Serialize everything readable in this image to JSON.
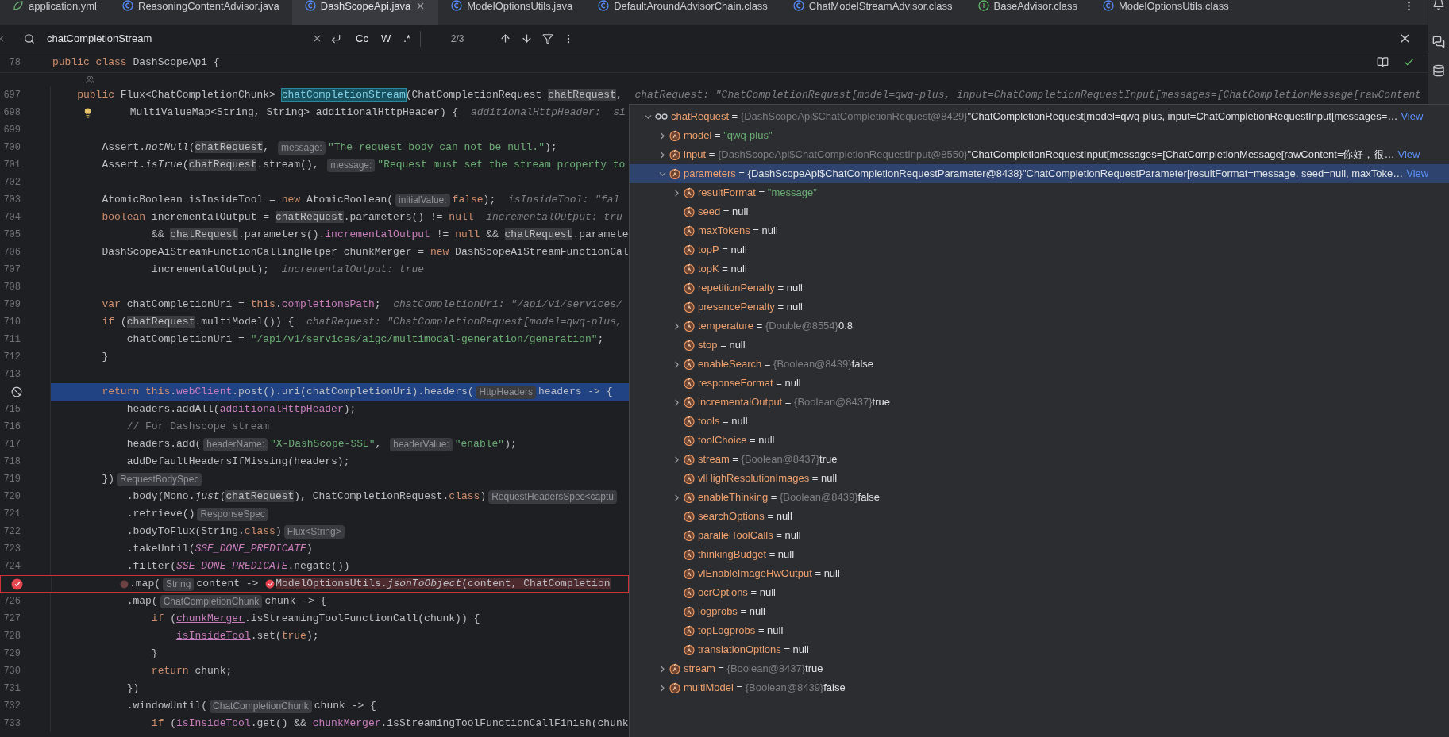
{
  "tabs": [
    {
      "label": "application.yml",
      "kind": "yaml",
      "selected": false
    },
    {
      "label": "ReasoningContentAdvisor.java",
      "kind": "class",
      "selected": false
    },
    {
      "label": "DashScopeApi.java",
      "kind": "class",
      "selected": true
    },
    {
      "label": "ModelOptionsUtils.java",
      "kind": "class",
      "selected": false
    },
    {
      "label": "DefaultAroundAdvisorChain.class",
      "kind": "class",
      "selected": false
    },
    {
      "label": "ChatModelStreamAdvisor.class",
      "kind": "class",
      "selected": false
    },
    {
      "label": "BaseAdvisor.class",
      "kind": "interface",
      "selected": false
    },
    {
      "label": "ModelOptionsUtils.class",
      "kind": "class",
      "selected": false
    }
  ],
  "search": {
    "value": "chatCompletionStream",
    "options": [
      "Cc",
      "W",
      ".*"
    ],
    "counter": "2/3"
  },
  "editor": {
    "sticky_line": {
      "number": "78",
      "tokens": [
        {
          "kind": "kw",
          "text": "public class "
        },
        {
          "kind": "p",
          "text": "DashScopeApi {"
        }
      ]
    },
    "first_line": {
      "number": "697",
      "tokens": [
        {
          "kind": "kw",
          "text": "    public "
        },
        {
          "kind": "p",
          "text": "Flux<ChatCompletionChunk> "
        },
        {
          "kind": "m",
          "text": "chatCompletionStream"
        },
        {
          "kind": "p",
          "text": "(ChatCompletionRequest "
        },
        {
          "kind": "v",
          "text": "chatRequest"
        },
        {
          "kind": "p",
          "text": ",  "
        },
        {
          "kind": "d",
          "text": "chatRequest: \"ChatCompletionRequest[model=qwq-plus, input=ChatCompletionRequestInput[messages=[ChatCompletionMessage[rawContent"
        }
      ]
    },
    "lines": [
      {
        "number": "698",
        "current": false,
        "breakpoint": false,
        "tokens": [
          {
            "kind": "bulb"
          },
          {
            "kind": "p",
            "text": "      MultiValueMap<String, String> additionalHttpHeader) {  "
          },
          {
            "kind": "d",
            "text": "additionalHttpHeader:  si"
          }
        ]
      },
      {
        "number": "699",
        "current": false,
        "breakpoint": false
      },
      {
        "number": "700",
        "current": false,
        "breakpoint": false,
        "tokens": [
          {
            "kind": "p",
            "text": "        Assert."
          },
          {
            "kind": "i",
            "text": "notNull"
          },
          {
            "kind": "p",
            "text": "("
          },
          {
            "kind": "v",
            "text": "chatRequest"
          },
          {
            "kind": "p",
            "text": ", "
          },
          {
            "kind": "h",
            "text": "message:"
          },
          {
            "kind": "s",
            "text": "\"The request body can not be null.\""
          },
          {
            "kind": "p",
            "text": ");"
          }
        ]
      },
      {
        "number": "701",
        "current": false,
        "breakpoint": false,
        "tokens": [
          {
            "kind": "p",
            "text": "        Assert."
          },
          {
            "kind": "i",
            "text": "isTrue"
          },
          {
            "kind": "p",
            "text": "("
          },
          {
            "kind": "v",
            "text": "chatRequest"
          },
          {
            "kind": "p",
            "text": ".stream(), "
          },
          {
            "kind": "h",
            "text": "message:"
          },
          {
            "kind": "s",
            "text": "\"Request must set the stream property to"
          }
        ]
      },
      {
        "number": "702",
        "current": false,
        "breakpoint": false
      },
      {
        "number": "703",
        "current": false,
        "breakpoint": false,
        "tokens": [
          {
            "kind": "p",
            "text": "        AtomicBoolean isInsideTool = "
          },
          {
            "kind": "kw",
            "text": "new "
          },
          {
            "kind": "p",
            "text": "AtomicBoolean("
          },
          {
            "kind": "h",
            "text": "initialValue:"
          },
          {
            "kind": "kw",
            "text": "false"
          },
          {
            "kind": "p",
            "text": ");  "
          },
          {
            "kind": "d",
            "text": "isInsideTool: \"fal"
          }
        ]
      },
      {
        "number": "704",
        "current": false,
        "breakpoint": false,
        "tokens": [
          {
            "kind": "kw",
            "text": "        boolean "
          },
          {
            "kind": "p",
            "text": "incrementalOutput = "
          },
          {
            "kind": "v",
            "text": "chatRequest"
          },
          {
            "kind": "p",
            "text": ".parameters() != "
          },
          {
            "kind": "kw",
            "text": "null"
          },
          {
            "kind": "d",
            "text": "  incrementalOutput: tru"
          }
        ]
      },
      {
        "number": "705",
        "current": false,
        "breakpoint": false,
        "tokens": [
          {
            "kind": "p",
            "text": "                && "
          },
          {
            "kind": "v",
            "text": "chatRequest"
          },
          {
            "kind": "p",
            "text": ".parameters()."
          },
          {
            "kind": "f",
            "text": "incrementalOutput"
          },
          {
            "kind": "p",
            "text": " != "
          },
          {
            "kind": "kw",
            "text": "null"
          },
          {
            "kind": "p",
            "text": " && "
          },
          {
            "kind": "v",
            "text": "chatRequest"
          },
          {
            "kind": "p",
            "text": ".paramete"
          }
        ]
      },
      {
        "number": "706",
        "current": false,
        "breakpoint": false,
        "tokens": [
          {
            "kind": "p",
            "text": "        DashScopeAiStreamFunctionCallingHelper chunkMerger = "
          },
          {
            "kind": "kw",
            "text": "new "
          },
          {
            "kind": "p",
            "text": "DashScopeAiStreamFunctionCal"
          }
        ]
      },
      {
        "number": "707",
        "current": false,
        "breakpoint": false,
        "tokens": [
          {
            "kind": "p",
            "text": "                incrementalOutput);  "
          },
          {
            "kind": "d",
            "text": "incrementalOutput: true"
          }
        ]
      },
      {
        "number": "708",
        "current": false,
        "breakpoint": false
      },
      {
        "number": "709",
        "current": false,
        "breakpoint": false,
        "tokens": [
          {
            "kind": "kw",
            "text": "        var "
          },
          {
            "kind": "p",
            "text": "chatCompletionUri = "
          },
          {
            "kind": "kw",
            "text": "this"
          },
          {
            "kind": "p",
            "text": "."
          },
          {
            "kind": "f",
            "text": "completionsPath"
          },
          {
            "kind": "p",
            "text": ";  "
          },
          {
            "kind": "d",
            "text": "chatCompletionUri: \"/api/v1/services/"
          }
        ]
      },
      {
        "number": "710",
        "current": false,
        "breakpoint": false,
        "tokens": [
          {
            "kind": "kw",
            "text": "        if "
          },
          {
            "kind": "p",
            "text": "("
          },
          {
            "kind": "v",
            "text": "chatRequest"
          },
          {
            "kind": "p",
            "text": ".multiModel()) {  "
          },
          {
            "kind": "d",
            "text": "chatRequest: \"ChatCompletionRequest[model=qwq-plus,"
          }
        ]
      },
      {
        "number": "711",
        "current": false,
        "breakpoint": false,
        "tokens": [
          {
            "kind": "p",
            "text": "            chatCompletionUri = "
          },
          {
            "kind": "s",
            "text": "\"/api/v1/services/aigc/multimodal-generation/generation\""
          },
          {
            "kind": "p",
            "text": ";"
          }
        ]
      },
      {
        "number": "712",
        "current": false,
        "breakpoint": false,
        "tokens": [
          {
            "kind": "p",
            "text": "        }"
          }
        ]
      },
      {
        "number": "713",
        "current": false,
        "breakpoint": false
      },
      {
        "kind": "mute",
        "current": true,
        "breakpoint": false,
        "tokens": [
          {
            "kind": "kw",
            "text": "        return this"
          },
          {
            "kind": "p",
            "text": "."
          },
          {
            "kind": "f",
            "text": "webClient"
          },
          {
            "kind": "p",
            "text": ".post().uri(chatCompletionUri).headers("
          },
          {
            "kind": "h",
            "text": "HttpHeaders"
          },
          {
            "kind": "p",
            "text": "headers -> {"
          }
        ]
      },
      {
        "number": "715",
        "current": false,
        "breakpoint": false,
        "tokens": [
          {
            "kind": "p",
            "text": "            headers.addAll("
          },
          {
            "kind": "u",
            "text": "additionalHttpHeader"
          },
          {
            "kind": "p",
            "text": ");"
          }
        ]
      },
      {
        "number": "716",
        "current": false,
        "breakpoint": false,
        "tokens": [
          {
            "kind": "cm",
            "text": "            // For Dashscope stream"
          }
        ]
      },
      {
        "number": "717",
        "current": false,
        "breakpoint": false,
        "tokens": [
          {
            "kind": "p",
            "text": "            headers.add("
          },
          {
            "kind": "h",
            "text": "headerName:"
          },
          {
            "kind": "s",
            "text": "\"X-DashScope-SSE\""
          },
          {
            "kind": "p",
            "text": ", "
          },
          {
            "kind": "h",
            "text": "headerValue:"
          },
          {
            "kind": "s",
            "text": "\"enable\""
          },
          {
            "kind": "p",
            "text": ");"
          }
        ]
      },
      {
        "number": "718",
        "current": false,
        "breakpoint": false,
        "tokens": [
          {
            "kind": "p",
            "text": "            addDefaultHeadersIfMissing(headers);"
          }
        ]
      },
      {
        "number": "719",
        "current": false,
        "breakpoint": false,
        "tokens": [
          {
            "kind": "p",
            "text": "        })"
          },
          {
            "kind": "h",
            "text": "RequestBodySpec"
          }
        ]
      },
      {
        "number": "720",
        "current": false,
        "breakpoint": false,
        "tokens": [
          {
            "kind": "p",
            "text": "            .body(Mono."
          },
          {
            "kind": "i",
            "text": "just"
          },
          {
            "kind": "p",
            "text": "("
          },
          {
            "kind": "v",
            "text": "chatRequest"
          },
          {
            "kind": "p",
            "text": "), ChatCompletionRequest."
          },
          {
            "kind": "kw",
            "text": "class"
          },
          {
            "kind": "p",
            "text": ")"
          },
          {
            "kind": "h",
            "text": "RequestHeadersSpec<captu"
          }
        ]
      },
      {
        "number": "721",
        "current": false,
        "breakpoint": false,
        "tokens": [
          {
            "kind": "p",
            "text": "            .retrieve()"
          },
          {
            "kind": "h",
            "text": "ResponseSpec"
          }
        ]
      },
      {
        "number": "722",
        "current": false,
        "breakpoint": false,
        "tokens": [
          {
            "kind": "p",
            "text": "            .bodyToFlux(String."
          },
          {
            "kind": "kw",
            "text": "class"
          },
          {
            "kind": "p",
            "text": ")"
          },
          {
            "kind": "h",
            "text": "Flux<String>"
          }
        ]
      },
      {
        "number": "723",
        "current": false,
        "breakpoint": false,
        "tokens": [
          {
            "kind": "p",
            "text": "            .takeUntil("
          },
          {
            "kind": "c",
            "text": "SSE_DONE_PREDICATE"
          },
          {
            "kind": "p",
            "text": ")"
          }
        ]
      },
      {
        "number": "724",
        "current": false,
        "breakpoint": false,
        "tokens": [
          {
            "kind": "p",
            "text": "            .filter("
          },
          {
            "kind": "c",
            "text": "SSE_DONE_PREDICATE"
          },
          {
            "kind": "p",
            "text": ".negate())"
          }
        ]
      },
      {
        "kind": "breakpoint",
        "current": false,
        "breakpoint": true,
        "tokens": [
          {
            "kind": "bp-off"
          },
          {
            "kind": "p",
            "text": ".map("
          },
          {
            "kind": "h",
            "text": "String"
          },
          {
            "kind": "p",
            "text": "content -> "
          },
          {
            "kind": "bp"
          },
          {
            "kind": "r",
            "text": "ModelOptionsUtils."
          },
          {
            "kind": "ri",
            "text": "jsonToObject"
          },
          {
            "kind": "r",
            "text": "(content, ChatCompletion"
          }
        ]
      },
      {
        "number": "726",
        "current": false,
        "breakpoint": false,
        "tokens": [
          {
            "kind": "p",
            "text": "            .map("
          },
          {
            "kind": "h",
            "text": "ChatCompletionChunk"
          },
          {
            "kind": "p",
            "text": "chunk -> {"
          }
        ]
      },
      {
        "number": "727",
        "current": false,
        "breakpoint": false,
        "tokens": [
          {
            "kind": "kw",
            "text": "                if "
          },
          {
            "kind": "p",
            "text": "("
          },
          {
            "kind": "u",
            "text": "chunkMerger"
          },
          {
            "kind": "p",
            "text": ".isStreamingToolFunctionCall(chunk)) {"
          }
        ]
      },
      {
        "number": "728",
        "current": false,
        "breakpoint": false,
        "tokens": [
          {
            "kind": "u",
            "text": "                    isInsideTool"
          },
          {
            "kind": "p",
            "text": ".set("
          },
          {
            "kind": "kw",
            "text": "true"
          },
          {
            "kind": "p",
            "text": ");"
          }
        ]
      },
      {
        "number": "729",
        "current": false,
        "breakpoint": false,
        "tokens": [
          {
            "kind": "p",
            "text": "                }"
          }
        ]
      },
      {
        "number": "730",
        "current": false,
        "breakpoint": false,
        "tokens": [
          {
            "kind": "kw",
            "text": "                return "
          },
          {
            "kind": "p",
            "text": "chunk;"
          }
        ]
      },
      {
        "number": "731",
        "current": false,
        "breakpoint": false,
        "tokens": [
          {
            "kind": "p",
            "text": "            })"
          }
        ]
      },
      {
        "number": "732",
        "current": false,
        "breakpoint": false,
        "tokens": [
          {
            "kind": "p",
            "text": "            .windowUntil("
          },
          {
            "kind": "h",
            "text": "ChatCompletionChunk"
          },
          {
            "kind": "p",
            "text": "chunk -> {"
          }
        ]
      },
      {
        "number": "733",
        "current": false,
        "breakpoint": false,
        "tokens": [
          {
            "kind": "kw",
            "text": "                if "
          },
          {
            "kind": "p",
            "text": "("
          },
          {
            "kind": "u",
            "text": "isInsideTool"
          },
          {
            "kind": "p",
            "text": ".get() && "
          },
          {
            "kind": "u",
            "text": "chunkMerger"
          },
          {
            "kind": "p",
            "text": ".isStreamingToolFunctionCallFinish(chunk"
          }
        ]
      }
    ]
  },
  "debug_popup": {
    "tree": [
      {
        "name": "chatRequest",
        "op": "=",
        "kind": "watch",
        "type": "{DashScopeApi$ChatCompletionRequest@8429}",
        "value": "\"ChatCompletionRequest[model=qwq-plus, input=ChatCompletionRequestInput[messages=…",
        "link": "View",
        "expanded": true,
        "selected": false,
        "children": [
          {
            "name": "model",
            "op": "=",
            "kind": "string",
            "value": "\"qwq-plus\"",
            "expanded": false,
            "selected": false
          },
          {
            "name": "input",
            "op": "=",
            "kind": "field",
            "type": "{DashScopeApi$ChatCompletionRequestInput@8550}",
            "value": "\"ChatCompletionRequestInput[messages=[ChatCompletionMessage[rawContent=你好，很…",
            "link": "View",
            "expanded": false,
            "selected": false
          },
          {
            "name": "parameters",
            "op": "=",
            "kind": "field",
            "type": "{DashScopeApi$ChatCompletionRequestParameter@8438}",
            "value": "\"ChatCompletionRequestParameter[resultFormat=message, seed=null, maxToke…",
            "link": "View",
            "expanded": true,
            "selected": true,
            "children": [
              {
                "name": "resultFormat",
                "op": "=",
                "kind": "string",
                "value": "\"message\"",
                "expanded": false,
                "selected": false
              },
              {
                "name": "seed",
                "op": "=",
                "kind": "field",
                "value": "null",
                "selected": false
              },
              {
                "name": "maxTokens",
                "op": "=",
                "kind": "field",
                "value": "null",
                "selected": false
              },
              {
                "name": "topP",
                "op": "=",
                "kind": "field",
                "value": "null",
                "selected": false
              },
              {
                "name": "topK",
                "op": "=",
                "kind": "field",
                "value": "null",
                "selected": false
              },
              {
                "name": "repetitionPenalty",
                "op": "=",
                "kind": "field",
                "value": "null",
                "selected": false
              },
              {
                "name": "presencePenalty",
                "op": "=",
                "kind": "field",
                "value": "null",
                "selected": false
              },
              {
                "name": "temperature",
                "op": "=",
                "kind": "field",
                "type": "{Double@8554}",
                "value": "0.8",
                "expanded": false,
                "selected": false
              },
              {
                "name": "stop",
                "op": "=",
                "kind": "field",
                "value": "null",
                "selected": false
              },
              {
                "name": "enableSearch",
                "op": "=",
                "kind": "field",
                "type": "{Boolean@8439}",
                "value": "false",
                "expanded": false,
                "selected": false
              },
              {
                "name": "responseFormat",
                "op": "=",
                "kind": "field",
                "value": "null",
                "selected": false
              },
              {
                "name": "incrementalOutput",
                "op": "=",
                "kind": "field",
                "type": "{Boolean@8437}",
                "value": "true",
                "expanded": false,
                "selected": false
              },
              {
                "name": "tools",
                "op": "=",
                "kind": "field",
                "value": "null",
                "selected": false
              },
              {
                "name": "toolChoice",
                "op": "=",
                "kind": "field",
                "value": "null",
                "selected": false
              },
              {
                "name": "stream",
                "op": "=",
                "kind": "field",
                "type": "{Boolean@8437}",
                "value": "true",
                "expanded": false,
                "selected": false
              },
              {
                "name": "vlHighResolutionImages",
                "op": "=",
                "kind": "field",
                "value": "null",
                "selected": false
              },
              {
                "name": "enableThinking",
                "op": "=",
                "kind": "field",
                "type": "{Boolean@8439}",
                "value": "false",
                "expanded": false,
                "selected": false
              },
              {
                "name": "searchOptions",
                "op": "=",
                "kind": "field",
                "value": "null",
                "selected": false
              },
              {
                "name": "parallelToolCalls",
                "op": "=",
                "kind": "field",
                "value": "null",
                "selected": false
              },
              {
                "name": "thinkingBudget",
                "op": "=",
                "kind": "field",
                "value": "null",
                "selected": false
              },
              {
                "name": "vlEnableImageHwOutput",
                "op": "=",
                "kind": "field",
                "value": "null",
                "selected": false
              },
              {
                "name": "ocrOptions",
                "op": "=",
                "kind": "field",
                "value": "null",
                "selected": false
              },
              {
                "name": "logprobs",
                "op": "=",
                "kind": "field",
                "value": "null",
                "selected": false
              },
              {
                "name": "topLogprobs",
                "op": "=",
                "kind": "field",
                "value": "null",
                "selected": false
              },
              {
                "name": "translationOptions",
                "op": "=",
                "kind": "field",
                "value": "null",
                "selected": false
              }
            ]
          },
          {
            "name": "stream",
            "op": "=",
            "kind": "field",
            "type": "{Boolean@8437}",
            "value": "true",
            "expanded": false,
            "selected": false
          },
          {
            "name": "multiModel",
            "op": "=",
            "kind": "field",
            "type": "{Boolean@8439}",
            "value": "false",
            "expanded": false,
            "selected": false
          }
        ]
      }
    ]
  }
}
